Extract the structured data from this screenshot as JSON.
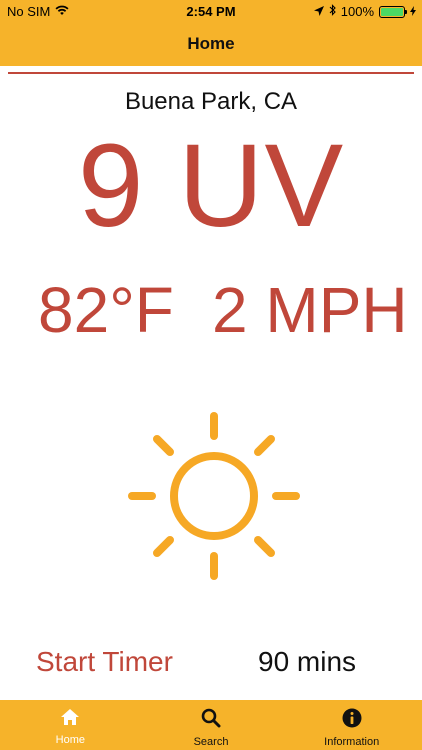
{
  "status_bar": {
    "carrier": "No SIM",
    "time": "2:54 PM",
    "battery": "100%"
  },
  "nav": {
    "title": "Home"
  },
  "weather": {
    "location": "Buena Park, CA",
    "uv": "9 UV",
    "temperature": "82°F",
    "wind": "2 MPH"
  },
  "timer": {
    "start_label": "Start Timer",
    "duration": "90 mins"
  },
  "tabs": [
    {
      "label": "Home",
      "icon": "home-icon",
      "active": true
    },
    {
      "label": "Search",
      "icon": "search-icon",
      "active": false
    },
    {
      "label": "Information",
      "icon": "info-icon",
      "active": false
    }
  ],
  "colors": {
    "bar": "#F6B32A",
    "accent": "#C0473A",
    "sun": "#F6A825"
  }
}
